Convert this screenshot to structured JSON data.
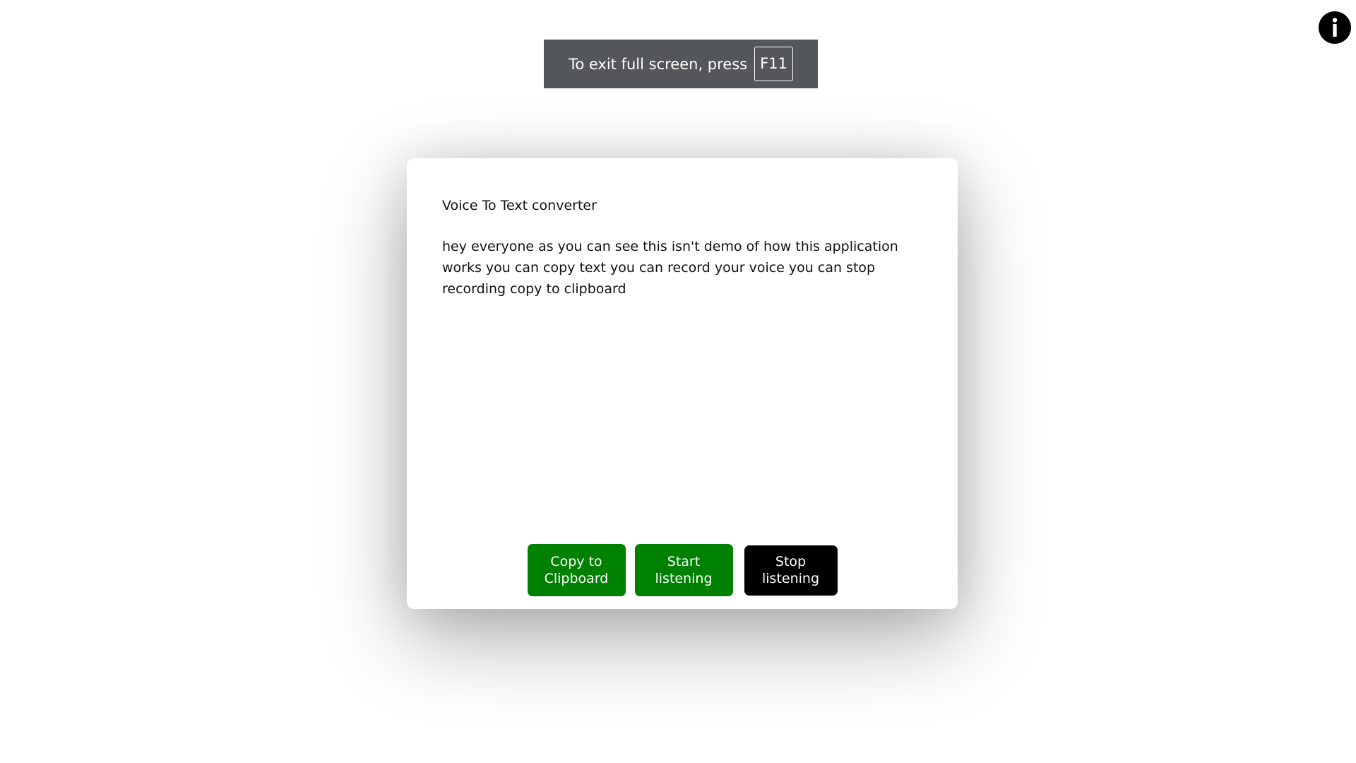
{
  "fullscreen_banner": {
    "text": "To exit full screen, press",
    "key": "F11"
  },
  "info_button": {
    "icon": "info-icon"
  },
  "card": {
    "title": "Voice To Text converter",
    "transcript": "hey everyone as you can see this isn't demo of how this application works you can copy text you can record your voice you can stop recording copy to clipboard",
    "buttons": {
      "copy_label": "Copy to\nClipboard",
      "start_label": "Start\nlistening",
      "stop_label": "Stop\nlistening"
    }
  },
  "colors": {
    "banner_bg": "#54575a",
    "button_green": "#008000",
    "button_black": "#000000"
  }
}
